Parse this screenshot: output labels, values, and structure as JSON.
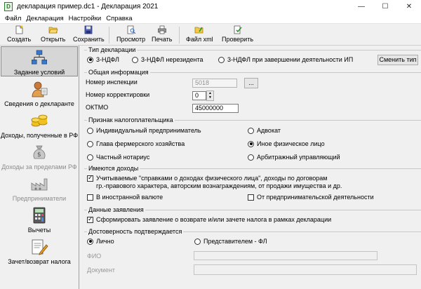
{
  "window": {
    "title": "декларация пример.dc1 - Декларация 2021",
    "minimize": "—",
    "maximize": "☐",
    "close": "✕"
  },
  "menu": [
    "Файл",
    "Декларация",
    "Настройки",
    "Справка"
  ],
  "toolbar": {
    "create": "Создать",
    "open": "Открыть",
    "save": "Сохранить",
    "preview": "Просмотр",
    "print": "Печать",
    "xml": "Файл xml",
    "check": "Проверить"
  },
  "sidebar": {
    "items": [
      {
        "label": "Задание условий",
        "icon": "network-icon"
      },
      {
        "label": "Сведения о декларанте",
        "icon": "person-icon"
      },
      {
        "label": "Доходы, полученные в РФ",
        "icon": "coins-icon"
      },
      {
        "label": "Доходы за пределами РФ",
        "icon": "money-bag-icon"
      },
      {
        "label": "Предприниматели",
        "icon": "factory-icon"
      },
      {
        "label": "Вычеты",
        "icon": "calculator-icon"
      },
      {
        "label": "Зачет/возврат налога",
        "icon": "pen-paper-icon"
      }
    ]
  },
  "decl_type": {
    "title": "Тип декларации",
    "options": [
      "3-НДФЛ",
      "3-НДФЛ нерезидента",
      "3-НДФЛ при завершении деятельности ИП"
    ],
    "selected": "3-НДФЛ",
    "change_button": "Сменить тип"
  },
  "general": {
    "title": "Общая информация",
    "inspection_label": "Номер инспекции",
    "inspection_value": "5018",
    "browse_button": "...",
    "correction_label": "Номер корректировки",
    "correction_value": "0",
    "oktmo_label": "ОКТМО",
    "oktmo_value": "45000000"
  },
  "taxpayer": {
    "title": "Признак налогоплательщика",
    "options": [
      "Индивидуальный предприниматель",
      "Адвокат",
      "Глава фермерского хозяйства",
      "Иное физическое лицо",
      "Частный нотариус",
      "Арбитражный управляющий"
    ],
    "selected": "Иное физическое лицо"
  },
  "income": {
    "title": "Имеются доходы",
    "certificate_line1": "Учитываемые \"справками о доходах физического лица\", доходы по договорам",
    "certificate_line2": "гр.-правового характера, авторским вознаграждениям, от продажи имущества и др.",
    "certificate_checked": true,
    "foreign": "В иностранной валюте",
    "foreign_checked": false,
    "non_entrepreneur": "От предпринимательской деятельности",
    "non_entrepreneur_checked": false
  },
  "statement": {
    "title": "Данные заявления",
    "refund": "Сформировать заявление о  возврате и/или зачете налога в рамках декларации",
    "refund_checked": true
  },
  "confirm": {
    "title": "Достоверность подтверждается",
    "personal": "Лично",
    "representative": "Представителем - ФЛ",
    "selected": "Лично",
    "fio_label": "ФИО",
    "doc_label": "Документ"
  }
}
